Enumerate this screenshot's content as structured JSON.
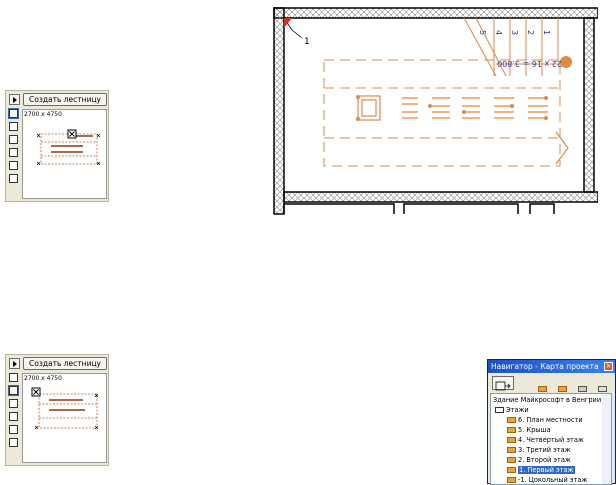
{
  "stair_tool": {
    "create_label": "Создать лестницу",
    "size_label": "2700 x 4750"
  },
  "plan": {
    "marker_label": "1",
    "flight_label": "22 x 16 = 3.800",
    "step_numbers": [
      "5",
      "4",
      "3",
      "2",
      "1"
    ],
    "accent_color": "#e2884a",
    "dimension_color": "#2a3ea8"
  },
  "navigator": {
    "title": "Навигатор - Карта проекта",
    "project": "Здание Майкрософт в Венгрии",
    "group": "Этажи",
    "stories": [
      "6. План местности",
      "5. Крыша",
      "4. Четвертый этаж",
      "3. Третий этаж",
      "2. Второй этаж",
      "1. Первый этаж",
      "-1. Цокольный этаж"
    ],
    "selected": "1. Первый этаж"
  }
}
